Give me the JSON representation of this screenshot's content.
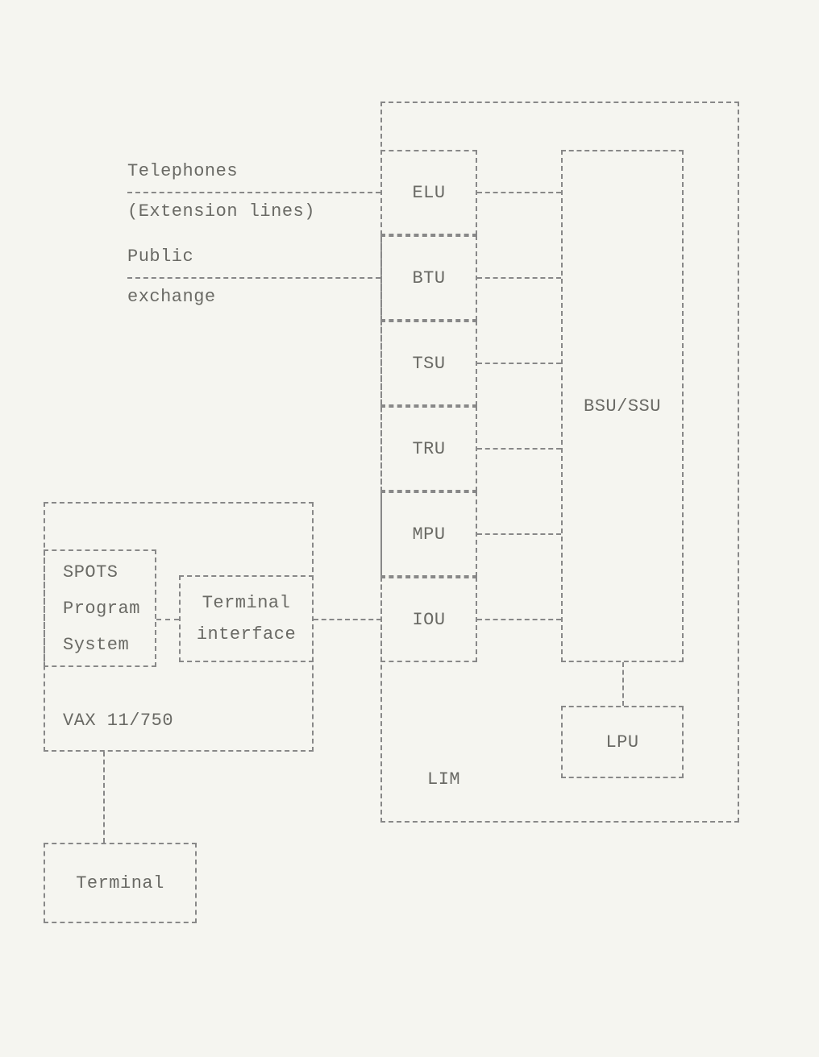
{
  "external": {
    "telephones": "Telephones",
    "extension_lines": "(Extension lines)",
    "public": "Public",
    "exchange": "exchange"
  },
  "vax": {
    "spots_l1": "SPOTS",
    "spots_l2": "Program",
    "spots_l3": "System",
    "terminal_l1": "Terminal",
    "terminal_l2": "interface",
    "name": "VAX 11/750"
  },
  "terminal": "Terminal",
  "lim": {
    "elu": "ELU",
    "btu": "BTU",
    "tsu": "TSU",
    "tru": "TRU",
    "mpu": "MPU",
    "iou": "IOU",
    "bsu": "BSU/SSU",
    "lpu": "LPU",
    "label": "LIM"
  }
}
